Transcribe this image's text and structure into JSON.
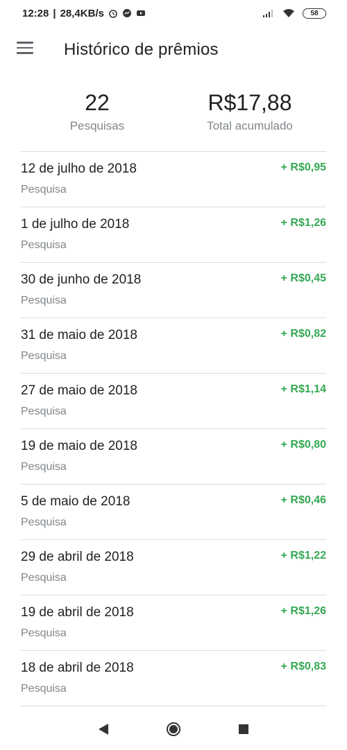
{
  "status_bar": {
    "time": "12:28",
    "speed": "28,4KB/s",
    "battery": "58",
    "icons": [
      "alarm-icon",
      "messenger-icon",
      "youtube-icon",
      "signal-icon",
      "wifi-icon",
      "battery-icon"
    ]
  },
  "header": {
    "title": "Histórico de prêmios",
    "menu_icon": "menu-icon"
  },
  "summary": {
    "surveys_count": "22",
    "surveys_label": "Pesquisas",
    "total_amount": "R$17,88",
    "total_label": "Total acumulado"
  },
  "colors": {
    "accent_green": "#34a853",
    "text_primary": "#202124",
    "text_secondary": "#80868b"
  },
  "rewards": [
    {
      "date": "12 de julho de 2018",
      "type": "Pesquisa",
      "amount": "+ R$0,95"
    },
    {
      "date": "1 de julho de 2018",
      "type": "Pesquisa",
      "amount": "+ R$1,26"
    },
    {
      "date": "30 de junho de 2018",
      "type": "Pesquisa",
      "amount": "+ R$0,45"
    },
    {
      "date": "31 de maio de 2018",
      "type": "Pesquisa",
      "amount": "+ R$0,82"
    },
    {
      "date": "27 de maio de 2018",
      "type": "Pesquisa",
      "amount": "+ R$1,14"
    },
    {
      "date": "19 de maio de 2018",
      "type": "Pesquisa",
      "amount": "+ R$0,80"
    },
    {
      "date": "5 de maio de 2018",
      "type": "Pesquisa",
      "amount": "+ R$0,46"
    },
    {
      "date": "29 de abril de 2018",
      "type": "Pesquisa",
      "amount": "+ R$1,22"
    },
    {
      "date": "19 de abril de 2018",
      "type": "Pesquisa",
      "amount": "+ R$1,26"
    },
    {
      "date": "18 de abril de 2018",
      "type": "Pesquisa",
      "amount": "+ R$0,83"
    }
  ],
  "nav_bar": {
    "icons": [
      "back-icon",
      "home-icon",
      "recents-icon"
    ]
  }
}
